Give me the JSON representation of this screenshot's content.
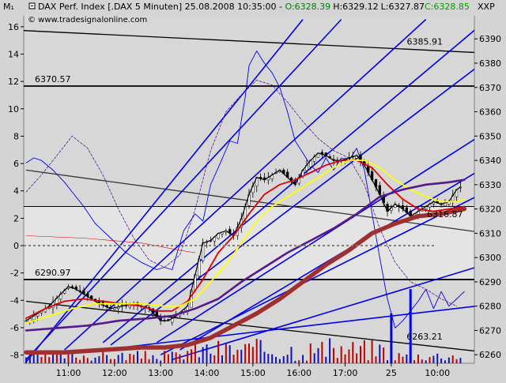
{
  "header": {
    "corner_label": "M₁",
    "instrument": "DAX Perf. Index [.DAX  5 Minuten] 25.08.2008 10:35:00 - ",
    "open": "O:6328.39",
    "high": "H:6329.12",
    "low": "L:6327.87",
    "close": "C:6328.85",
    "right_label": "XXP",
    "watermark": "© www.tradesignalonline.com"
  },
  "colors": {
    "plot_bg": "#d7d7d7",
    "plot_band": "#e4e4e4",
    "open_color": "#008000",
    "close_color": "#00a000",
    "blue": "#0000ee",
    "red": "#e00000",
    "yellow": "#ffff00",
    "purple": "#551a8b",
    "brown": "#9e3030",
    "black": "#000000"
  },
  "chart_data": {
    "type": "line",
    "left_axis": {
      "ylim": [
        -8.6,
        16.8
      ],
      "ticks": [
        "16",
        "14",
        "12",
        "10",
        "8",
        "6",
        "4",
        "2",
        "0",
        "-2",
        "-4",
        "-6",
        "-8"
      ]
    },
    "right_axis": {
      "ylim": [
        6256.5,
        6399.5
      ],
      "ticks": [
        "6390",
        "6380",
        "6370",
        "6360",
        "6350",
        "6340",
        "6330",
        "6320",
        "6310",
        "6300",
        "6290",
        "6280",
        "6270",
        "6260"
      ]
    },
    "x_ticks": [
      "11:00",
      "12:00",
      "13:00",
      "14:00",
      "15:00",
      "16:00",
      "17:00",
      "25",
      "10:00"
    ],
    "x_tick_index": [
      11,
      23,
      35,
      47,
      59,
      71,
      83,
      95,
      107
    ],
    "bar_count": 117,
    "horizontal_levels": [
      {
        "label": "6370.57",
        "value": 6370.57
      },
      {
        "label": "6290.97",
        "value": 6290.97
      },
      {
        "label": "6321",
        "value": 6321
      }
    ],
    "trendlines": [
      {
        "label": "6385.91",
        "p0": [
          -8,
          6394
        ],
        "p1": [
          135,
          6383
        ]
      },
      {
        "label": "6263.21",
        "p0": [
          0,
          6282
        ],
        "p1": [
          117,
          6261.5
        ]
      },
      {
        "label": "",
        "p0": [
          0,
          6336
        ],
        "p1": [
          120,
          6310
        ]
      }
    ],
    "fan_lines": [
      {
        "p0": [
          0,
          6257
        ],
        "p1": [
          72,
          6398
        ]
      },
      {
        "p0": [
          0,
          6258
        ],
        "p1": [
          82,
          6398
        ]
      },
      {
        "p0": [
          10,
          6262
        ],
        "p1": [
          104,
          6398
        ]
      },
      {
        "p0": [
          20,
          6265
        ],
        "p1": [
          120,
          6398
        ]
      },
      {
        "p0": [
          22,
          6264
        ],
        "p1": [
          117,
          6378
        ]
      },
      {
        "p0": [
          34,
          6265
        ],
        "p1": [
          117,
          6349
        ]
      },
      {
        "p0": [
          40,
          6262
        ],
        "p1": [
          117,
          6335
        ]
      },
      {
        "p0": [
          35,
          6260
        ],
        "p1": [
          117,
          6325
        ]
      },
      {
        "p0": [
          38,
          6258
        ],
        "p1": [
          117,
          6296
        ]
      },
      {
        "p0": [
          25,
          6263
        ],
        "p1": [
          117,
          6280
        ]
      }
    ],
    "price_last_label": "6316.87",
    "price_curve": [
      [
        0,
        6274
      ],
      [
        3,
        6277
      ],
      [
        6,
        6280
      ],
      [
        9,
        6285
      ],
      [
        11,
        6288
      ],
      [
        13,
        6287
      ],
      [
        16,
        6284
      ],
      [
        19,
        6281
      ],
      [
        22,
        6279
      ],
      [
        25,
        6280
      ],
      [
        28,
        6281
      ],
      [
        30,
        6280
      ],
      [
        32,
        6279
      ],
      [
        35,
        6274
      ],
      [
        37,
        6274
      ],
      [
        39,
        6276
      ],
      [
        42,
        6280
      ],
      [
        44,
        6293
      ],
      [
        46,
        6306
      ],
      [
        48,
        6307
      ],
      [
        50,
        6310
      ],
      [
        52,
        6311
      ],
      [
        54,
        6309
      ],
      [
        56,
        6316
      ],
      [
        58,
        6326
      ],
      [
        60,
        6333
      ],
      [
        62,
        6332
      ],
      [
        64,
        6334
      ],
      [
        66,
        6336
      ],
      [
        68,
        6333
      ],
      [
        70,
        6330
      ],
      [
        72,
        6336
      ],
      [
        74,
        6340
      ],
      [
        76,
        6343
      ],
      [
        78,
        6342
      ],
      [
        80,
        6340
      ],
      [
        82,
        6340
      ],
      [
        84,
        6341
      ],
      [
        86,
        6342
      ],
      [
        88,
        6338
      ],
      [
        90,
        6332
      ],
      [
        92,
        6326
      ],
      [
        94,
        6319
      ],
      [
        96,
        6322
      ],
      [
        98,
        6320
      ],
      [
        100,
        6317
      ],
      [
        102,
        6319
      ],
      [
        104,
        6321
      ],
      [
        106,
        6323
      ],
      [
        108,
        6322
      ],
      [
        110,
        6323
      ],
      [
        112,
        6328
      ],
      [
        113,
        6329
      ]
    ],
    "volume_spikes": [
      [
        95,
        6277
      ],
      [
        100,
        6287
      ]
    ],
    "series": [
      {
        "color_key": "red",
        "width": 1.8,
        "points": [
          [
            0,
            6275
          ],
          [
            5,
            6279
          ],
          [
            10,
            6282
          ],
          [
            15,
            6283
          ],
          [
            20,
            6282
          ],
          [
            25,
            6281
          ],
          [
            30,
            6280
          ],
          [
            34,
            6278
          ],
          [
            38,
            6278
          ],
          [
            42,
            6282
          ],
          [
            46,
            6291
          ],
          [
            50,
            6302
          ],
          [
            54,
            6309
          ],
          [
            58,
            6318
          ],
          [
            62,
            6326
          ],
          [
            66,
            6330
          ],
          [
            70,
            6332
          ],
          [
            74,
            6335
          ],
          [
            78,
            6338
          ],
          [
            82,
            6340
          ],
          [
            86,
            6340
          ],
          [
            90,
            6337
          ],
          [
            94,
            6330
          ],
          [
            98,
            6324
          ],
          [
            102,
            6320
          ],
          [
            106,
            6319
          ],
          [
            110,
            6320
          ],
          [
            114,
            6321
          ]
        ]
      },
      {
        "color_key": "yellow",
        "width": 1.8,
        "points": [
          [
            0,
            6273
          ],
          [
            6,
            6276
          ],
          [
            12,
            6279
          ],
          [
            18,
            6281
          ],
          [
            24,
            6281
          ],
          [
            30,
            6281
          ],
          [
            36,
            6280
          ],
          [
            40,
            6280
          ],
          [
            44,
            6283
          ],
          [
            48,
            6290
          ],
          [
            52,
            6297
          ],
          [
            56,
            6306
          ],
          [
            60,
            6315
          ],
          [
            64,
            6321
          ],
          [
            68,
            6325
          ],
          [
            72,
            6329
          ],
          [
            76,
            6333
          ],
          [
            80,
            6337
          ],
          [
            84,
            6340
          ],
          [
            88,
            6340
          ],
          [
            92,
            6337
          ],
          [
            96,
            6332
          ],
          [
            100,
            6328
          ],
          [
            104,
            6325
          ],
          [
            108,
            6323
          ],
          [
            112,
            6323
          ],
          [
            114,
            6324
          ]
        ]
      },
      {
        "color_key": "purple",
        "width": 2.6,
        "points": [
          [
            0,
            6270
          ],
          [
            8,
            6271
          ],
          [
            16,
            6272
          ],
          [
            24,
            6274
          ],
          [
            32,
            6275
          ],
          [
            38,
            6276
          ],
          [
            44,
            6279
          ],
          [
            50,
            6283
          ],
          [
            56,
            6290
          ],
          [
            62,
            6296
          ],
          [
            68,
            6302
          ],
          [
            74,
            6307
          ],
          [
            80,
            6312
          ],
          [
            86,
            6318
          ],
          [
            92,
            6325
          ],
          [
            98,
            6328
          ],
          [
            104,
            6330
          ],
          [
            110,
            6331
          ],
          [
            114,
            6332
          ]
        ]
      },
      {
        "color_key": "brown",
        "width": 5.5,
        "points": [
          [
            0,
            6261
          ],
          [
            10,
            6261
          ],
          [
            20,
            6262
          ],
          [
            30,
            6263
          ],
          [
            36,
            6263
          ],
          [
            42,
            6264
          ],
          [
            48,
            6267
          ],
          [
            54,
            6272
          ],
          [
            60,
            6277
          ],
          [
            66,
            6283
          ],
          [
            72,
            6290
          ],
          [
            78,
            6297
          ],
          [
            84,
            6303
          ],
          [
            90,
            6310
          ],
          [
            96,
            6314
          ],
          [
            102,
            6317
          ],
          [
            108,
            6318
          ],
          [
            114,
            6320
          ]
        ]
      },
      {
        "color_key": "blue",
        "width": 0.9,
        "points": [
          [
            0,
            6339
          ],
          [
            2,
            6341
          ],
          [
            4,
            6340
          ],
          [
            7,
            6336
          ],
          [
            10,
            6331
          ],
          [
            12,
            6327
          ],
          [
            15,
            6321
          ],
          [
            18,
            6314
          ],
          [
            22,
            6308
          ],
          [
            26,
            6302
          ],
          [
            30,
            6298
          ],
          [
            34,
            6295
          ],
          [
            36,
            6296
          ],
          [
            38,
            6295
          ],
          [
            41,
            6311
          ],
          [
            44,
            6318
          ],
          [
            46,
            6315
          ],
          [
            48,
            6330
          ],
          [
            50,
            6337
          ],
          [
            53,
            6348
          ],
          [
            55,
            6347
          ],
          [
            57,
            6366
          ],
          [
            58,
            6379
          ],
          [
            60,
            6385
          ],
          [
            62,
            6380
          ],
          [
            64,
            6376
          ],
          [
            66,
            6370
          ],
          [
            68,
            6360
          ],
          [
            70,
            6348
          ],
          [
            72,
            6343
          ],
          [
            74,
            6338
          ],
          [
            76,
            6335
          ],
          [
            78,
            6341
          ],
          [
            80,
            6336
          ],
          [
            82,
            6341
          ],
          [
            84,
            6340
          ],
          [
            86,
            6345
          ],
          [
            88,
            6336
          ],
          [
            90,
            6318
          ],
          [
            92,
            6300
          ],
          [
            94,
            6283
          ],
          [
            96,
            6271
          ],
          [
            98,
            6274
          ],
          [
            100,
            6278
          ],
          [
            102,
            6282
          ],
          [
            104,
            6287
          ],
          [
            106,
            6279
          ],
          [
            108,
            6286
          ],
          [
            110,
            6280
          ],
          [
            112,
            6283
          ],
          [
            114,
            6286
          ]
        ]
      },
      {
        "color_key": "purple",
        "width": 0.8,
        "dash": "3,2",
        "points": [
          [
            0,
            6327
          ],
          [
            4,
            6334
          ],
          [
            8,
            6342
          ],
          [
            12,
            6350
          ],
          [
            16,
            6345
          ],
          [
            20,
            6334
          ],
          [
            24,
            6320
          ],
          [
            28,
            6308
          ],
          [
            32,
            6299
          ],
          [
            36,
            6296
          ],
          [
            40,
            6301
          ],
          [
            44,
            6320
          ],
          [
            48,
            6344
          ],
          [
            52,
            6360
          ],
          [
            56,
            6367
          ],
          [
            60,
            6373
          ],
          [
            64,
            6371
          ],
          [
            68,
            6364
          ],
          [
            72,
            6356
          ],
          [
            76,
            6349
          ],
          [
            80,
            6344
          ],
          [
            84,
            6341
          ],
          [
            88,
            6330
          ],
          [
            92,
            6312
          ],
          [
            96,
            6298
          ],
          [
            100,
            6290
          ],
          [
            104,
            6287
          ],
          [
            108,
            6283
          ],
          [
            112,
            6280
          ]
        ]
      },
      {
        "color_key": "red",
        "width": 0.6,
        "points": [
          [
            0,
            6309
          ],
          [
            15,
            6308
          ],
          [
            30,
            6306
          ],
          [
            40,
            6303
          ],
          [
            44,
            6302
          ]
        ]
      }
    ]
  }
}
